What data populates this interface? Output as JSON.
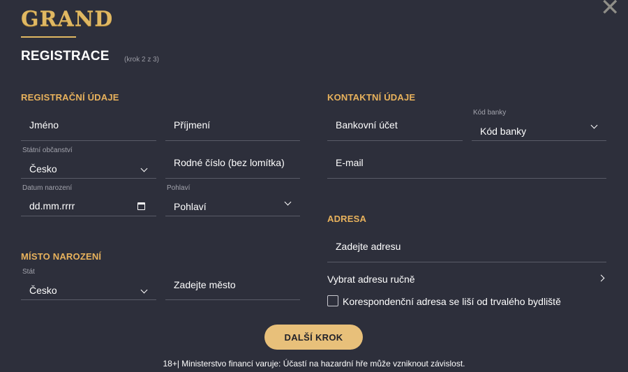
{
  "brand": {
    "logo_text": "GRAND"
  },
  "header": {
    "title": "REGISTRACE",
    "step": "(krok 2 z 3)",
    "close_icon": "close-icon"
  },
  "sections": {
    "registration": "REGISTRAČNÍ ÚDAJE",
    "contact": "KONTAKTNÍ ÚDAJE",
    "birthplace": "MÍSTO NAROZENÍ",
    "address": "ADRESA"
  },
  "fields": {
    "first_name": {
      "placeholder": "Jméno"
    },
    "last_name": {
      "placeholder": "Příjmení"
    },
    "citizenship": {
      "label": "Státní občanství",
      "value": "Česko"
    },
    "birth_number": {
      "placeholder": "Rodné číslo (bez lomítka)"
    },
    "birth_date": {
      "label": "Datum narození",
      "value": "dd.mm.rrrr"
    },
    "gender": {
      "label": "Pohlaví",
      "value": "Pohlaví"
    },
    "birth_country": {
      "label": "Stát",
      "value": "Česko"
    },
    "birth_city": {
      "placeholder": "Zadejte město"
    },
    "bank_account": {
      "placeholder": "Bankovní účet"
    },
    "bank_code": {
      "label": "Kód banky",
      "value": "Kód banky"
    },
    "email": {
      "placeholder": "E-mail"
    },
    "address": {
      "placeholder": "Zadejte adresu"
    }
  },
  "address_manual": "Vybrat adresu ručně",
  "correspondence_checkbox": {
    "label": "Korespondenční adresa se liší od trvalého bydliště",
    "checked": false
  },
  "next_button": "DALŠÍ KROK",
  "footer": "18+| Ministerstvo financí varuje: Účastí na hazardní hře může vzniknout závislost.",
  "colors": {
    "background": "#2d2f3b",
    "accent": "#e8b25c",
    "button": "#e8c07a"
  }
}
